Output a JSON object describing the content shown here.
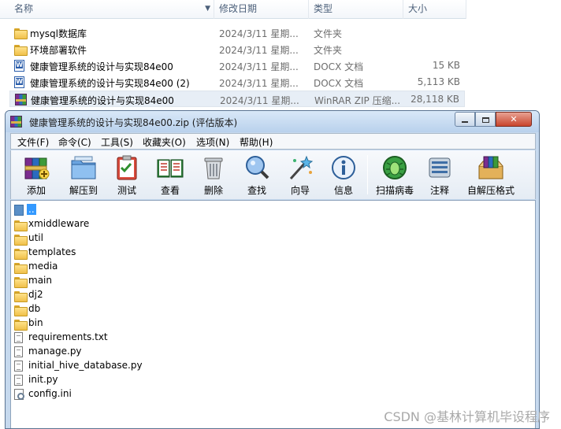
{
  "explorer": {
    "columns": {
      "name": "名称",
      "date": "修改日期",
      "type": "类型",
      "size": "大小"
    },
    "files": [
      {
        "name": "mysql数据库",
        "date": "2024/3/11 星期...",
        "type": "文件夹",
        "size": "",
        "icon": "folder-icon"
      },
      {
        "name": "环境部署软件",
        "date": "2024/3/11 星期...",
        "type": "文件夹",
        "size": "",
        "icon": "folder-icon"
      },
      {
        "name": "健康管理系统的设计与实现84e00",
        "date": "2024/3/11 星期...",
        "type": "DOCX 文档",
        "size": "15 KB",
        "icon": "docx-icon"
      },
      {
        "name": "健康管理系统的设计与实现84e00 (2)",
        "date": "2024/3/11 星期...",
        "type": "DOCX 文档",
        "size": "5,113 KB",
        "icon": "docx-icon"
      },
      {
        "name": "健康管理系统的设计与实现84e00",
        "date": "2024/3/11 星期...",
        "type": "WinRAR ZIP 压缩...",
        "size": "28,118 KB",
        "icon": "winrar-zip-icon",
        "selected": true
      }
    ]
  },
  "winrar": {
    "title": "健康管理系统的设计与实现84e00.zip (评估版本)",
    "menu": [
      "文件(F)",
      "命令(C)",
      "工具(S)",
      "收藏夹(O)",
      "选项(N)",
      "帮助(H)"
    ],
    "tools": [
      {
        "label": "添加",
        "icon": "add-archive-icon"
      },
      {
        "label": "解压到",
        "icon": "extract-to-icon"
      },
      {
        "label": "测试",
        "icon": "test-icon"
      },
      {
        "label": "查看",
        "icon": "view-book-icon"
      },
      {
        "label": "删除",
        "icon": "trash-icon"
      },
      {
        "label": "查找",
        "icon": "find-icon"
      },
      {
        "label": "向导",
        "icon": "wizard-icon"
      },
      {
        "label": "信息",
        "icon": "info-icon"
      },
      {
        "label": "扫描病毒",
        "icon": "virus-scan-icon"
      },
      {
        "label": "注释",
        "icon": "comment-icon"
      },
      {
        "label": "自解压格式",
        "icon": "sfx-icon"
      }
    ],
    "entries": [
      {
        "name": "..",
        "kind": "up"
      },
      {
        "name": "xmiddleware",
        "kind": "folder"
      },
      {
        "name": "util",
        "kind": "folder"
      },
      {
        "name": "templates",
        "kind": "folder"
      },
      {
        "name": "media",
        "kind": "folder"
      },
      {
        "name": "main",
        "kind": "folder"
      },
      {
        "name": "dj2",
        "kind": "folder"
      },
      {
        "name": "db",
        "kind": "folder"
      },
      {
        "name": "bin",
        "kind": "folder"
      },
      {
        "name": "requirements.txt",
        "kind": "file"
      },
      {
        "name": "manage.py",
        "kind": "file"
      },
      {
        "name": "initial_hive_database.py",
        "kind": "file"
      },
      {
        "name": "init.py",
        "kind": "file"
      },
      {
        "name": "config.ini",
        "kind": "ini"
      }
    ]
  },
  "watermark": "CSDN @基林计算机毕设程序"
}
